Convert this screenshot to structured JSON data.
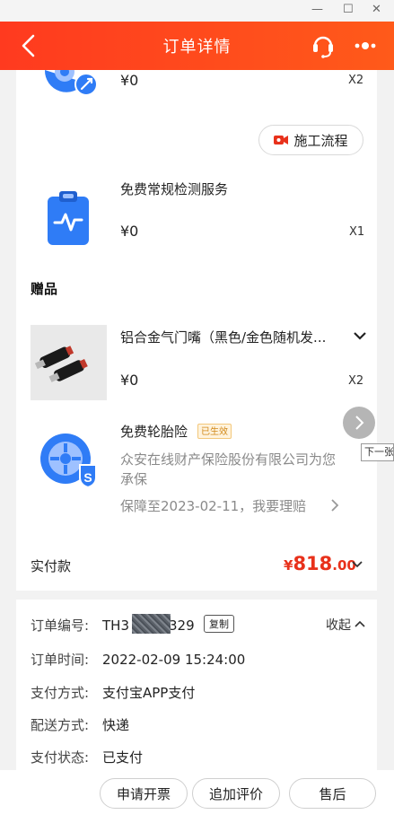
{
  "header": {
    "title": "订单详情"
  },
  "titlebar": {
    "minimize": "—",
    "maximize": "☐",
    "close": "✕"
  },
  "items": [
    {
      "price": "¥0",
      "qty": "X2"
    },
    {
      "name": "免费常规检测服务",
      "price": "¥0",
      "qty": "X1"
    }
  ],
  "flow_button": "施工流程",
  "gift": {
    "title": "赠品",
    "product": {
      "name": "铝合金气门嘴（黑色/金色随机发...",
      "price": "¥0",
      "qty": "X2"
    },
    "insurance": {
      "name": "免费轮胎险",
      "badge": "已生效",
      "desc": "众安在线财产保险股份有限公司为您承保",
      "desc_line1": "众安在线财产保险股份有限公司为您",
      "desc_line2": "承保",
      "validity": "保障至2023-02-11，我要理赔"
    }
  },
  "payment": {
    "label": "实付款",
    "symbol": "¥",
    "amount_int": "818",
    "amount_dec": ".00"
  },
  "order_info": {
    "order_no_label": "订单编号:",
    "order_no_prefix": "TH3",
    "order_no_suffix": "329",
    "copy_label": "复制",
    "collapse_label": "收起",
    "time_label": "订单时间:",
    "time_value": "2022-02-09 15:24:00",
    "pay_method_label": "支付方式:",
    "pay_method_value": "支付宝APP支付",
    "delivery_label": "配送方式:",
    "delivery_value": "快递",
    "pay_status_label": "支付状态:",
    "pay_status_value": "已支付"
  },
  "bottom": {
    "invoice": "申请开票",
    "review": "追加评价",
    "after_sales": "售后"
  },
  "next_tip": "下一张",
  "colors": {
    "brand": "#ff3a1f",
    "price_red": "#e8311b",
    "icon_blue": "#2f7cf6"
  }
}
